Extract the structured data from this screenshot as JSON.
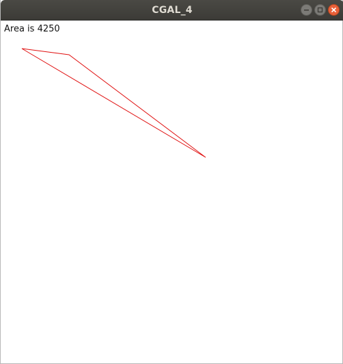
{
  "window": {
    "title": "CGAL_4"
  },
  "canvas": {
    "area_text": "Area is 4250",
    "polygon_color": "#e01010",
    "polygon_vertex_count": 3
  },
  "icons": {
    "minimize": "minimize-icon",
    "maximize": "maximize-icon",
    "close": "close-icon"
  }
}
